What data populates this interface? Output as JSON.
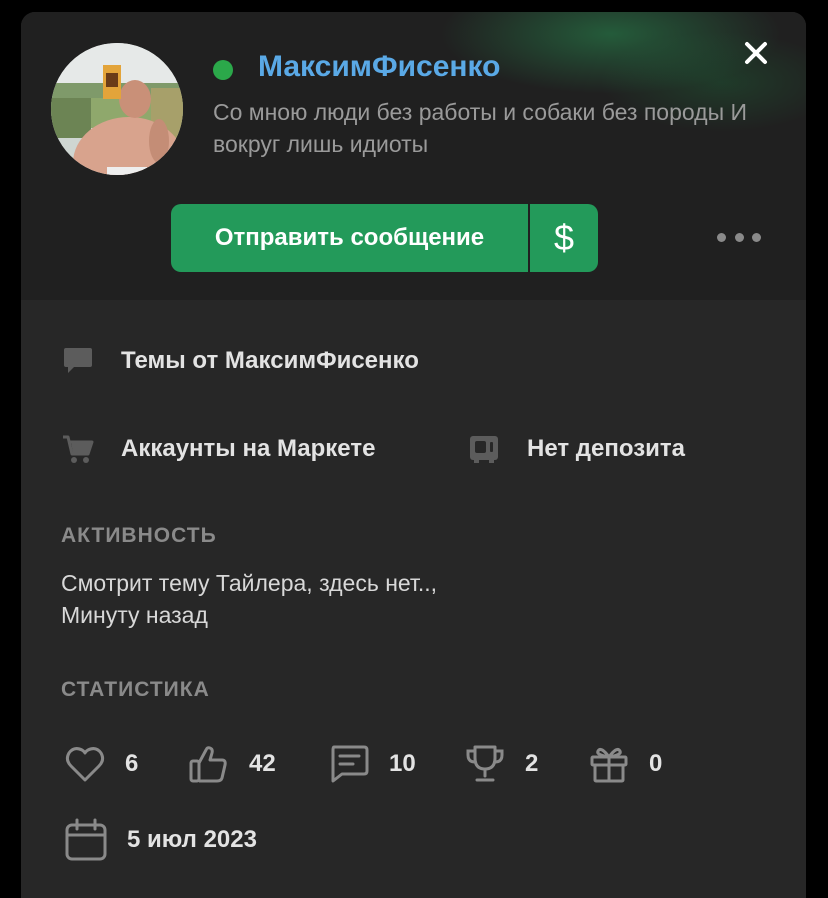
{
  "profile": {
    "username": "МаксимФисенко",
    "status": "Со мною люди без работы и собаки без породы И вокруг лишь идиоты",
    "online": true,
    "username_color": "#5aa9e6",
    "online_color": "#2ba84a"
  },
  "actions": {
    "send_message_label": "Отправить сообщение",
    "money_label": "$",
    "close_icon": "close-icon",
    "more_icon": "more-horizontal-icon",
    "accent_color": "#239a5a"
  },
  "links": {
    "threads_label": "Темы от МаксимФисенко",
    "market_label": "Аккаунты на Маркете",
    "deposit_label": "Нет депозита"
  },
  "activity": {
    "title": "АКТИВНОСТЬ",
    "text": "Смотрит тему Тайлера, здесь нет.., Минуту назад"
  },
  "stats": {
    "title": "СТАТИСТИКА",
    "items": [
      {
        "icon": "heart-icon",
        "value": "6"
      },
      {
        "icon": "thumbs-up-icon",
        "value": "42"
      },
      {
        "icon": "message-icon",
        "value": "10"
      },
      {
        "icon": "trophy-icon",
        "value": "2"
      },
      {
        "icon": "gift-icon",
        "value": "0"
      }
    ],
    "joined_icon": "calendar-icon",
    "joined_date": "5 июл 2023"
  }
}
